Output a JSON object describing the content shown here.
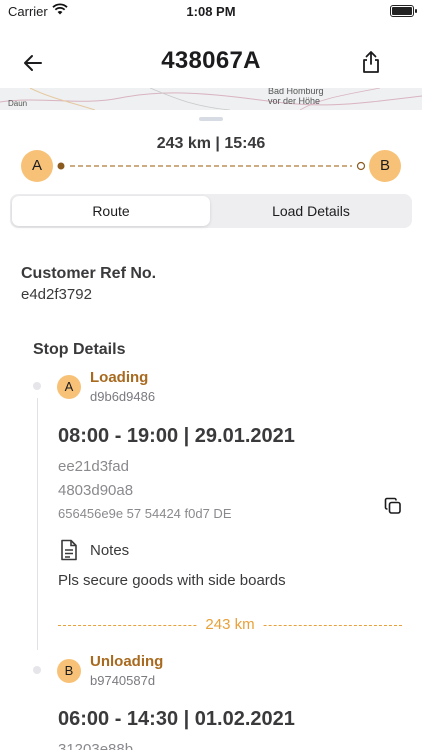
{
  "status_bar": {
    "carrier": "Carrier",
    "time": "1:08 PM"
  },
  "nav": {
    "title": "438067A"
  },
  "map": {
    "place_label_1": "Bad Homburg",
    "place_label_2": "vor der Höhe",
    "place_label_3": "Daun"
  },
  "route": {
    "summary": "243 km | 15:46",
    "start_label": "A",
    "end_label": "B"
  },
  "tabs": [
    {
      "label": "Route",
      "active": true
    },
    {
      "label": "Load Details",
      "active": false
    }
  ],
  "customer": {
    "label": "Customer Ref No.",
    "value": "e4d2f3792"
  },
  "stop_details": {
    "label": "Stop Details",
    "stops": [
      {
        "marker": "A",
        "type": "Loading",
        "code": "d9b6d9486",
        "time": "08:00 - 19:00 | 29.01.2021",
        "line1": "ee21d3fad",
        "line2": "4803d90a8",
        "line3": "656456e9e 57 54424 f0d7 DE",
        "notes_label": "Notes",
        "notes_text": "Pls secure goods with side boards"
      },
      {
        "marker": "B",
        "type": "Unloading",
        "code": "b9740587d",
        "time": "06:00 - 14:30 | 01.02.2021",
        "line1": "31203e88b"
      }
    ],
    "distance": "243 km"
  },
  "colors": {
    "accent": "#f7c278",
    "brand_brown": "#a86a1f",
    "distance_orange": "#e8a13a"
  }
}
